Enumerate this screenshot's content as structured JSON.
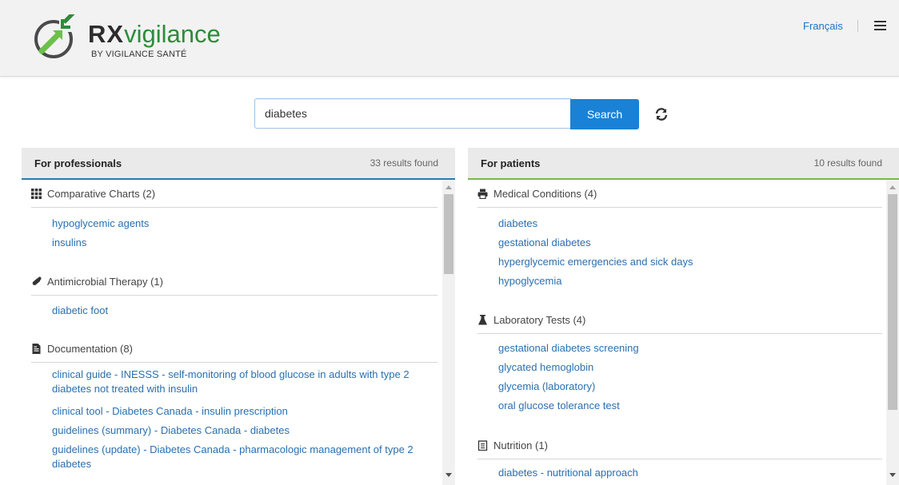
{
  "header": {
    "brand_rx": "RX",
    "brand_vigilance": "vigilance",
    "tagline": "BY VIGILANCE SANTÉ",
    "language_link": "Français",
    "menu_icon": "hamburger-menu-icon"
  },
  "search": {
    "value": "diabetes",
    "button_label": "Search",
    "refresh_icon": "refresh-icon"
  },
  "colors": {
    "brand_green": "#2e8b3a",
    "link_blue": "#2a6fb0",
    "button_blue": "#1a82d6",
    "professionals_accent": "#2a7ab0",
    "patients_accent": "#7ab648"
  },
  "professionals": {
    "title": "For professionals",
    "count": "33 results found",
    "categories": [
      {
        "label": "Comparative Charts (2)",
        "icon": "grid-icon",
        "items": [
          "hypoglycemic agents",
          "insulins"
        ]
      },
      {
        "label": "Antimicrobial Therapy (1)",
        "icon": "pill-icon",
        "items": [
          "diabetic foot"
        ]
      },
      {
        "label": "Documentation (8)",
        "icon": "document-icon",
        "items": [
          "clinical guide - INESSS - self-monitoring of blood glucose in adults with type 2 diabetes not treated with insulin",
          "clinical tool - Diabetes Canada - insulin prescription",
          "guidelines (summary) - Diabetes Canada - diabetes",
          "guidelines (update) - Diabetes Canada - pharmacologic management of type 2 diabetes"
        ]
      }
    ]
  },
  "patients": {
    "title": "For patients",
    "count": "10 results found",
    "categories": [
      {
        "label": "Medical Conditions (4)",
        "icon": "printer-icon",
        "items": [
          "diabetes",
          "gestational diabetes",
          "hyperglycemic emergencies and sick days",
          "hypoglycemia"
        ]
      },
      {
        "label": "Laboratory Tests (4)",
        "icon": "flask-icon",
        "items": [
          "gestational diabetes screening",
          "glycated hemoglobin",
          "glycemia (laboratory)",
          "oral glucose tolerance test"
        ]
      },
      {
        "label": "Nutrition (1)",
        "icon": "clipboard-icon",
        "items": [
          "diabetes - nutritional approach"
        ]
      }
    ]
  }
}
